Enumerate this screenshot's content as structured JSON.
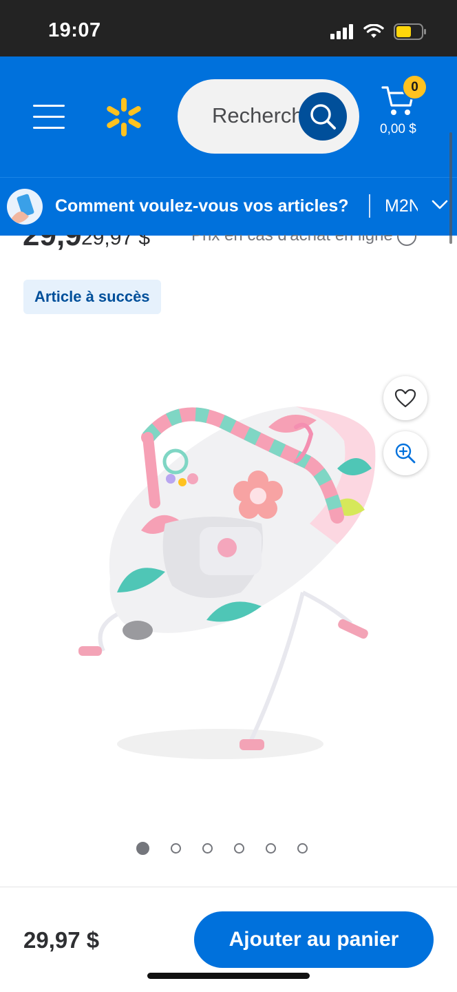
{
  "status_bar": {
    "time": "19:07",
    "icons": [
      "signal-icon",
      "wifi-icon",
      "battery-icon"
    ]
  },
  "header": {
    "menu_icon": "hamburger-menu-icon",
    "logo_icon": "walmart-spark-logo",
    "search": {
      "placeholder": "Recherch",
      "icon": "search-icon"
    },
    "cart": {
      "count": "0",
      "total": "0,00 $",
      "icon": "cart-icon"
    }
  },
  "delivery": {
    "prompt": "Comment voulez-vous vos articles?",
    "separator": "|",
    "store_code": "M2N",
    "icon": "phone-hand-icon",
    "chevron_icon": "chevron-down-icon"
  },
  "price_row": {
    "current_price": "29,9",
    "was_price": "29,97 $",
    "online_note": "Prix en cas d'achat en ligne",
    "info_icon": "info-icon"
  },
  "badge": {
    "label": "Article à succès"
  },
  "product": {
    "image_alt": "baby bouncer",
    "favorite_icon": "heart-icon",
    "zoom_icon": "zoom-in-icon",
    "carousel": {
      "total": 6,
      "active_index": 0
    }
  },
  "bottom_bar": {
    "price": "29,97 $",
    "add_to_cart_label": "Ajouter au panier"
  },
  "colors": {
    "walmart_blue": "#0071dc",
    "dark_blue": "#004f9a",
    "spark_yellow": "#ffc220",
    "status_bar": "#232323"
  }
}
